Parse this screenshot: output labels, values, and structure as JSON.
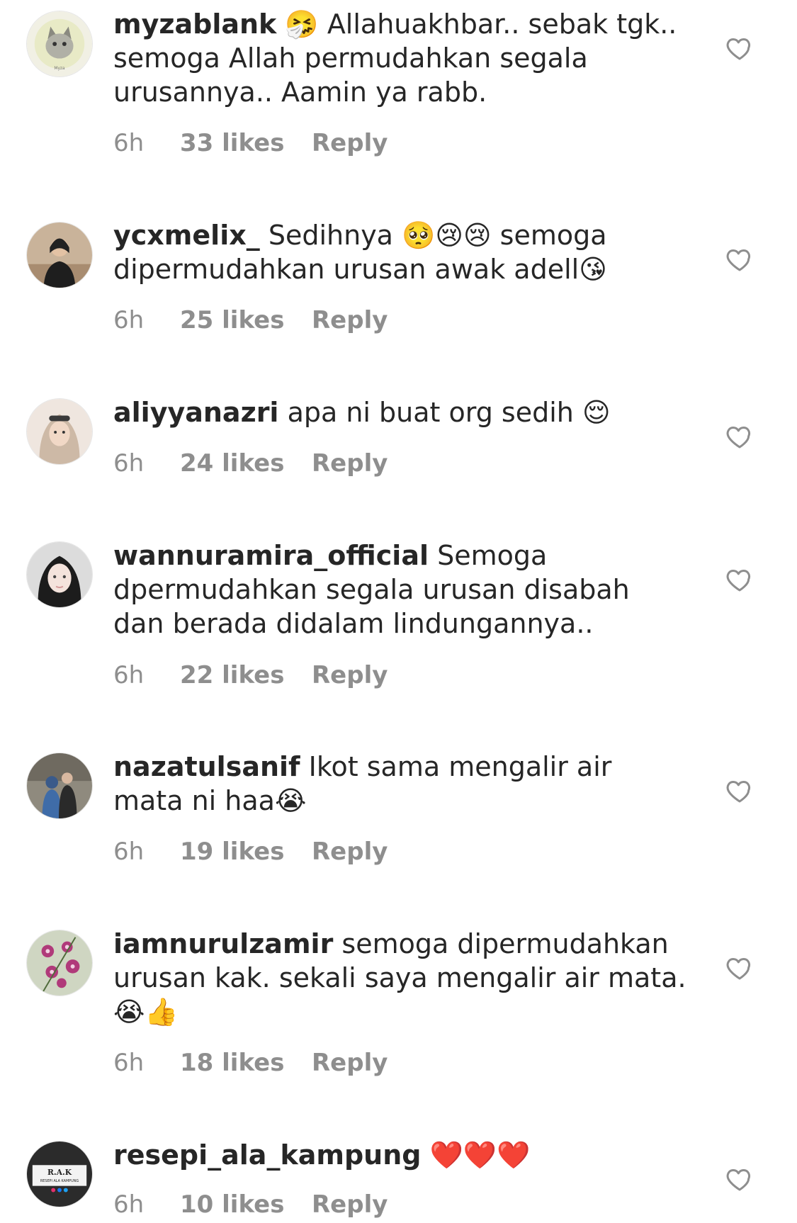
{
  "comments": [
    {
      "username": "myzablank",
      "text": "🤧 Allahuakhbar.. sebak tgk.. semoga Allah permudahkan segala urusannya.. Aamin ya rabb.",
      "time": "6h",
      "likes": "33 likes",
      "reply": "Reply",
      "avatar_desc": "cat-avatar"
    },
    {
      "username": "ycxmelix_",
      "text": "Sedihnya 🥺😢😢 semoga dipermudahkan urusan awak adell😘",
      "time": "6h",
      "likes": "25 likes",
      "reply": "Reply",
      "avatar_desc": "person-avatar"
    },
    {
      "username": "aliyyanazri",
      "text": "apa ni buat org sedih 😌",
      "time": "6h",
      "likes": "24 likes",
      "reply": "Reply",
      "avatar_desc": "hijab-avatar"
    },
    {
      "username": "wannuramira_official",
      "text": "Semoga dpermudahkan segala urusan disabah dan berada didalam lindungannya..",
      "time": "6h",
      "likes": "22 likes",
      "reply": "Reply",
      "avatar_desc": "hijab-avatar"
    },
    {
      "username": "nazatulsanif",
      "text": "Ikot sama mengalir air mata ni haa😭",
      "time": "6h",
      "likes": "19 likes",
      "reply": "Reply",
      "avatar_desc": "couple-avatar"
    },
    {
      "username": "iamnurulzamir",
      "text": "semoga dipermudahkan urusan kak. sekali saya mengalir air mata. 😭👍",
      "time": "6h",
      "likes": "18 likes",
      "reply": "Reply",
      "avatar_desc": "flower-avatar"
    },
    {
      "username": "resepi_ala_kampung",
      "text": "❤️❤️❤️",
      "time": "6h",
      "likes": "10 likes",
      "reply": "Reply",
      "avatar_desc": "logo-avatar",
      "avatar_logo_text": "R.A.K",
      "avatar_logo_sub": "RESEPI ALA KAMPUNG"
    }
  ]
}
